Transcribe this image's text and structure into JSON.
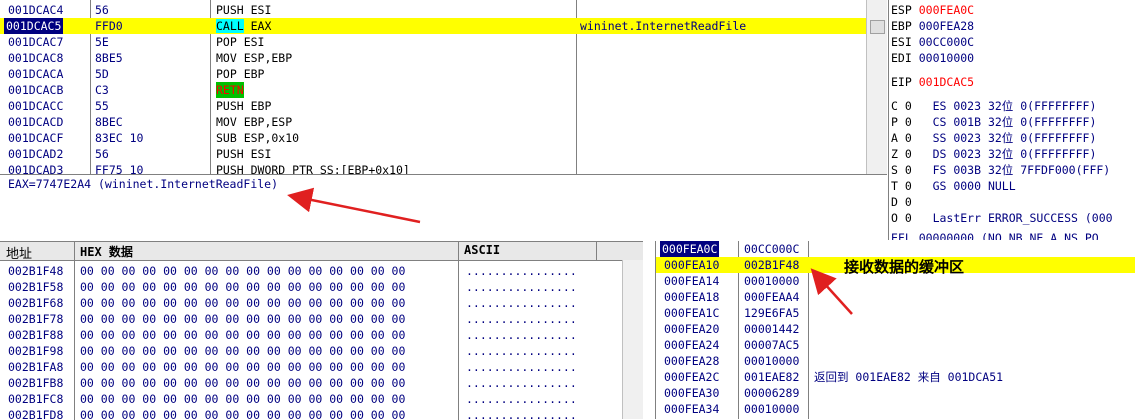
{
  "disasm": {
    "rows": [
      {
        "addr": "001DCAC4",
        "hex": "56",
        "asm": "PUSH ESI",
        "comment": ""
      },
      {
        "addr": "001DCAC5",
        "hex": "FFD0",
        "mnemonic": "CALL",
        "operand": " EAX",
        "comment": "wininet.InternetReadFile"
      },
      {
        "addr": "001DCAC7",
        "hex": "5E",
        "asm": "POP ESI",
        "comment": ""
      },
      {
        "addr": "001DCAC8",
        "hex": "8BE5",
        "asm": "MOV ESP,EBP",
        "comment": ""
      },
      {
        "addr": "001DCACA",
        "hex": "5D",
        "asm": "POP EBP",
        "comment": ""
      },
      {
        "addr": "001DCACB",
        "hex": "C3",
        "retn": "RETN",
        "comment": ""
      },
      {
        "addr": "001DCACC",
        "hex": "55",
        "asm": "PUSH EBP",
        "comment": ""
      },
      {
        "addr": "001DCACD",
        "hex": "8BEC",
        "asm": "MOV EBP,ESP",
        "comment": ""
      },
      {
        "addr": "001DCACF",
        "hex": "83EC 10",
        "asm": "SUB ESP,0x10",
        "comment": ""
      },
      {
        "addr": "001DCAD2",
        "hex": "56",
        "asm": "PUSH ESI",
        "comment": ""
      },
      {
        "addr": "001DCAD3",
        "hex": "FF75 10",
        "asm": "PUSH DWORD PTR SS:[EBP+0x10]",
        "comment": ""
      }
    ]
  },
  "info": {
    "text": "EAX=7747E2A4 (wininet.InternetReadFile)"
  },
  "registers": {
    "top": [
      {
        "name": "ESP",
        "value": "000FEA0C",
        "red": true
      },
      {
        "name": "EBP",
        "value": "000FEA28",
        "red": false
      },
      {
        "name": "ESI",
        "value": "00CC000C",
        "red": false
      },
      {
        "name": "EDI",
        "value": "00010000",
        "red": false
      }
    ],
    "eip": {
      "name": "EIP",
      "value": "001DCAC5"
    },
    "flags": [
      {
        "flag": "C 0",
        "seg": "ES 0023 32位 0(FFFFFFFF)"
      },
      {
        "flag": "P 0",
        "seg": "CS 001B 32位 0(FFFFFFFF)"
      },
      {
        "flag": "A 0",
        "seg": "SS 0023 32位 0(FFFFFFFF)"
      },
      {
        "flag": "Z 0",
        "seg": "DS 0023 32位 0(FFFFFFFF)"
      },
      {
        "flag": "S 0",
        "seg": "FS 003B 32位 7FFDF000(FFF)"
      },
      {
        "flag": "T 0",
        "seg": "GS 0000 NULL"
      },
      {
        "flag": "D 0",
        "seg": ""
      },
      {
        "flag": "O 0",
        "seg": "LastErr ERROR_SUCCESS (000"
      }
    ],
    "last_partial": "EFL 00000000 (NO,NB,NE,A,NS,PO"
  },
  "dump": {
    "headers": {
      "addr": "地址",
      "hex": "HEX 数据",
      "ascii": "ASCII"
    },
    "rows": [
      {
        "addr": "002B1F48",
        "hex": "00 00 00 00 00 00 00 00 00 00 00 00 00 00 00 00",
        "ascii": "................"
      },
      {
        "addr": "002B1F58",
        "hex": "00 00 00 00 00 00 00 00 00 00 00 00 00 00 00 00",
        "ascii": "................"
      },
      {
        "addr": "002B1F68",
        "hex": "00 00 00 00 00 00 00 00 00 00 00 00 00 00 00 00",
        "ascii": "................"
      },
      {
        "addr": "002B1F78",
        "hex": "00 00 00 00 00 00 00 00 00 00 00 00 00 00 00 00",
        "ascii": "................"
      },
      {
        "addr": "002B1F88",
        "hex": "00 00 00 00 00 00 00 00 00 00 00 00 00 00 00 00",
        "ascii": "................"
      },
      {
        "addr": "002B1F98",
        "hex": "00 00 00 00 00 00 00 00 00 00 00 00 00 00 00 00",
        "ascii": "................"
      },
      {
        "addr": "002B1FA8",
        "hex": "00 00 00 00 00 00 00 00 00 00 00 00 00 00 00 00",
        "ascii": "................"
      },
      {
        "addr": "002B1FB8",
        "hex": "00 00 00 00 00 00 00 00 00 00 00 00 00 00 00 00",
        "ascii": "................"
      },
      {
        "addr": "002B1FC8",
        "hex": "00 00 00 00 00 00 00 00 00 00 00 00 00 00 00 00",
        "ascii": "................"
      },
      {
        "addr": "002B1FD8",
        "hex": "00 00 00 00 00 00 00 00 00 00 00 00 00 00 00 00",
        "ascii": "................"
      }
    ]
  },
  "stack": {
    "annotation": "接收数据的缓冲区",
    "rows": [
      {
        "addr": "000FEA0C",
        "value": "00CC000C",
        "comment": ""
      },
      {
        "addr": "000FEA10",
        "value": "002B1F48",
        "comment": ""
      },
      {
        "addr": "000FEA14",
        "value": "00010000",
        "comment": ""
      },
      {
        "addr": "000FEA18",
        "value": "000FEAA4",
        "comment": ""
      },
      {
        "addr": "000FEA1C",
        "value": "129E6FA5",
        "comment": ""
      },
      {
        "addr": "000FEA20",
        "value": "00001442",
        "comment": ""
      },
      {
        "addr": "000FEA24",
        "value": "00007AC5",
        "comment": ""
      },
      {
        "addr": "000FEA28",
        "value": "00010000",
        "comment": ""
      },
      {
        "addr": "000FEA2C",
        "value": "001EAE82",
        "comment": "返回到 001EAE82 来自 001DCA51"
      },
      {
        "addr": "000FEA30",
        "value": "00006289",
        "comment": ""
      },
      {
        "addr": "000FEA34",
        "value": "00010000",
        "comment": ""
      }
    ]
  },
  "colors": {
    "text_blue": "#000080",
    "highlight_yellow": "#ffff00",
    "call_cyan": "#00ffff",
    "retn_green": "#00c000",
    "register_red": "#ff0000",
    "arrow_red": "#e02020"
  }
}
